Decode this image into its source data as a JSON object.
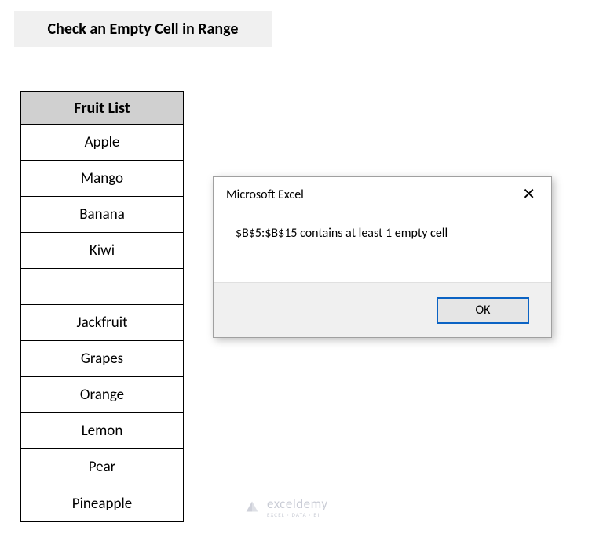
{
  "title": "Check an Empty Cell in Range",
  "table": {
    "header": "Fruit List",
    "rows": [
      "Apple",
      "Mango",
      "Banana",
      "Kiwi",
      "",
      "Jackfruit",
      "Grapes",
      "Orange",
      "Lemon",
      "Pear",
      "Pineapple"
    ]
  },
  "dialog": {
    "title": "Microsoft Excel",
    "message": "$B$5:$B$15 contains at least 1 empty cell",
    "ok_label": "OK"
  },
  "watermark": {
    "brand": "exceldemy",
    "tagline": "EXCEL · DATA · BI"
  }
}
